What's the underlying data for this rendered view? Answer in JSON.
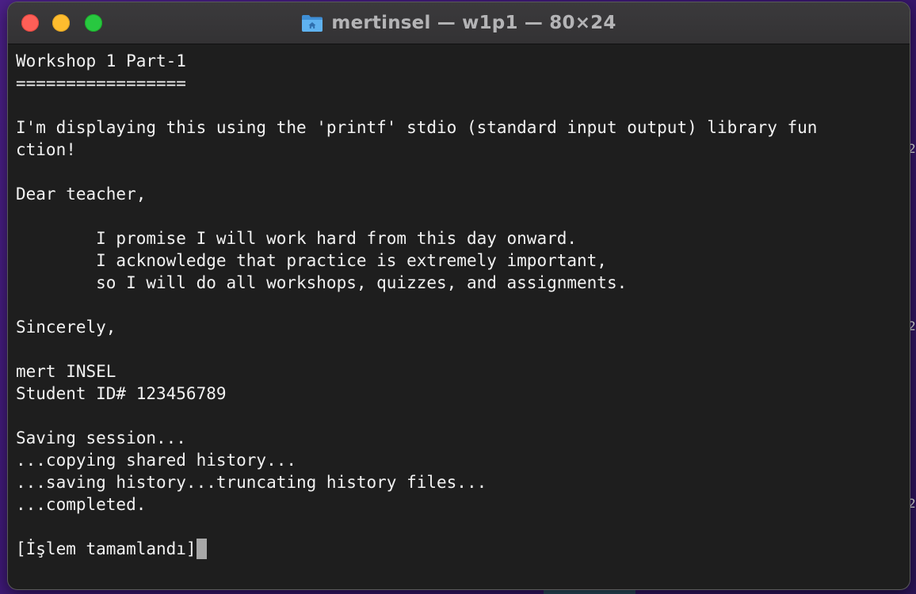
{
  "window": {
    "title": "mertinsel — w1p1 — 80×24"
  },
  "icons": {
    "title_icon": "home-folder-icon",
    "close": "close-button-red",
    "minimize": "minimize-button-yellow",
    "zoom": "zoom-button-green"
  },
  "colors": {
    "close": "#fe5f57",
    "minimize": "#febc2e",
    "zoom": "#28c840",
    "terminal_bg": "#1e1e1e",
    "terminal_fg": "#f2f2f2",
    "folder": "#4aa3e8"
  },
  "terminal": {
    "lines": [
      "Workshop 1 Part-1",
      "=================",
      "",
      "I'm displaying this using the 'printf' stdio (standard input output) library fun",
      "ction!",
      "",
      "Dear teacher,",
      "",
      "        I promise I will work hard from this day onward.",
      "        I acknowledge that practice is extremely important,",
      "        so I will do all workshops, quizzes, and assignments.",
      "",
      "Sincerely,",
      "",
      "mert INSEL",
      "Student ID# 123456789",
      "",
      "Saving session...",
      "...copying shared history...",
      "...saving history...truncating history files...",
      "...completed.",
      "",
      "[İşlem tamamlandı]"
    ]
  }
}
